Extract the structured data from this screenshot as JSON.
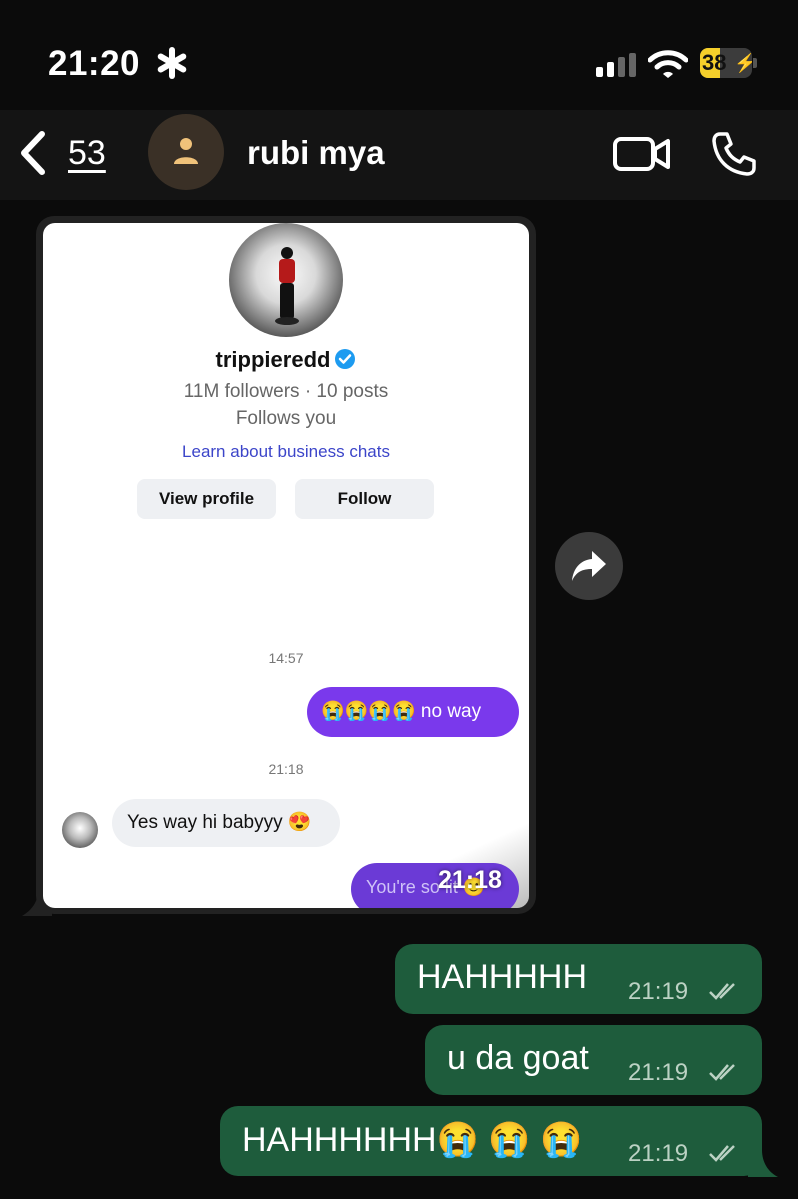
{
  "status_bar": {
    "time": "21:20",
    "battery_level": "38",
    "battery_fraction": 0.38,
    "accent": "#f5cf2b"
  },
  "header": {
    "back_count": "53",
    "contact_name": "rubi mya",
    "icons": [
      "chevron-left-icon",
      "person-icon",
      "video-camera-icon",
      "phone-icon"
    ]
  },
  "forwarded_image": {
    "profile": {
      "username": "trippieredd",
      "stats": "11M followers · 10 posts",
      "follows_you": "Follows you",
      "learn_link": "Learn about business chats",
      "view_profile_label": "View profile",
      "follow_label": "Follow"
    },
    "timestamp_1": "14:57",
    "sent_message": "😭😭😭😭 no way",
    "timestamp_2": "21:18",
    "received_message": "Yes way hi babyyy 😍",
    "partial_message": "You're so lit 🙂",
    "image_time": "21:18",
    "colors": {
      "sent_purple": "#7a39ec",
      "link_blue": "#3c45c9",
      "verified_blue": "#1d9bf0"
    }
  },
  "messages": [
    {
      "text": "HAHHHHH",
      "time": "21:19"
    },
    {
      "text": "u da goat",
      "time": "21:19"
    },
    {
      "text": "HAHHHHHH",
      "emojis": "😭 😭 😭",
      "time": "21:19"
    }
  ],
  "colors": {
    "outgoing_bubble": "#1e5c3c",
    "background": "#0b0b0b"
  }
}
